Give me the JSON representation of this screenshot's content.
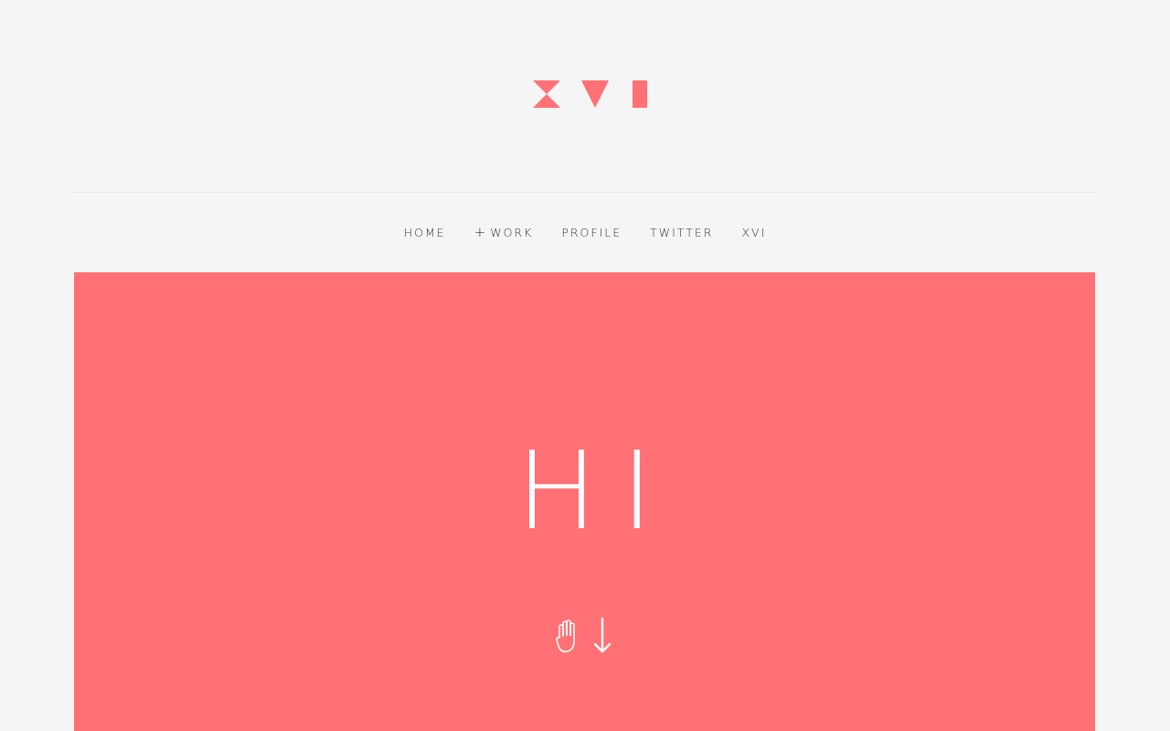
{
  "brand": {
    "logo_icon": "xvi-geometric-logo-icon",
    "accent_color": "#ff7174"
  },
  "nav": {
    "items": [
      {
        "label": "HOME",
        "icon": null
      },
      {
        "label": "WORK",
        "icon": "plus-icon",
        "icon_glyph": "+"
      },
      {
        "label": "PROFILE",
        "icon": null
      },
      {
        "label": "TWITTER",
        "icon": null
      },
      {
        "label": "XVI",
        "icon": null
      }
    ]
  },
  "hero": {
    "title": "HI",
    "background_color": "#ff7174",
    "scroll_cue_icons": [
      "hand-icon",
      "arrow-down-icon"
    ]
  }
}
